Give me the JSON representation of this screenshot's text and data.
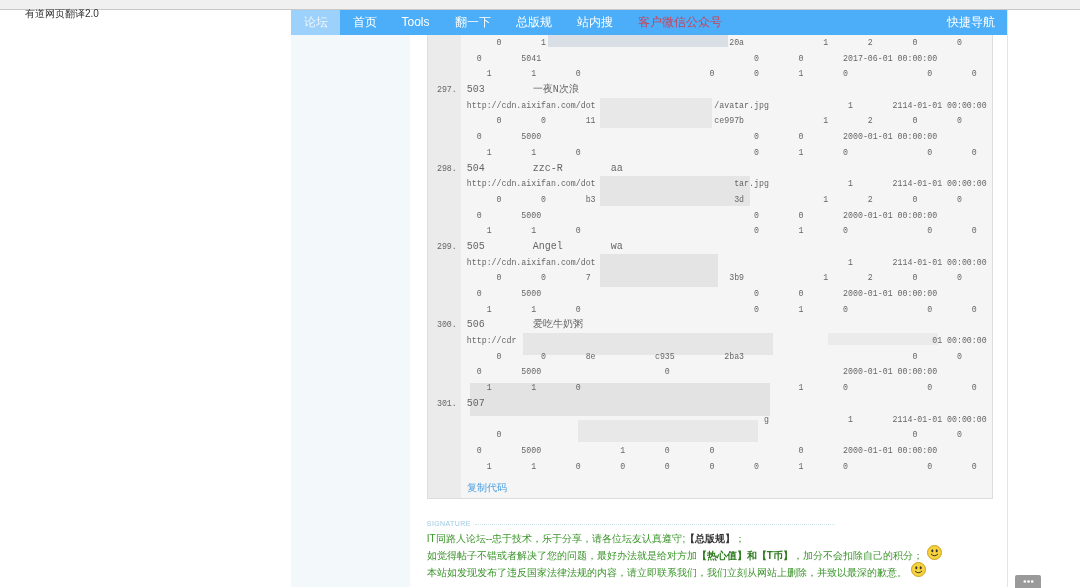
{
  "browser_bar": {
    "title": "有道网页翻译2.0"
  },
  "nav": {
    "items": [
      {
        "label": "论坛",
        "selected": true,
        "kind": "link"
      },
      {
        "label": "首页",
        "selected": false,
        "kind": "link"
      },
      {
        "label": "Tools",
        "selected": false,
        "kind": "link"
      },
      {
        "label": "翻一下",
        "selected": false,
        "kind": "link"
      },
      {
        "label": "总版规",
        "selected": false,
        "kind": "link"
      },
      {
        "label": "站内搜",
        "selected": false,
        "kind": "link"
      },
      {
        "label": "客户微信公众号",
        "selected": false,
        "kind": "promo"
      }
    ],
    "quick_nav": "快捷导航"
  },
  "code_block": {
    "lines": [
      {
        "text": "      0        1                                     20a                1        2        0        0"
      },
      {
        "text": "  0        5041                                           0        0        2017-06-01 00:00:00"
      },
      {
        "text": "    1        1        0                          0        0        1        0                0        0"
      },
      {
        "number": "297.",
        "text": "503        一夜N次浪"
      },
      {
        "text": "http://cdn.aixifan.com/dot                        /avatar.jpg                1        2114-01-01 00:00:00"
      },
      {
        "text": "      0        0        11                        ce997b                1        2        0        0"
      },
      {
        "text": "  0        5000                                           0        0        2000-01-01 00:00:00"
      },
      {
        "text": "    1        1        0                                   0        1        0                0        0"
      },
      {
        "number": "298.",
        "text": "504        zzc-R        aa"
      },
      {
        "text": "http://cdn.aixifan.com/dot                            tar.jpg                1        2114-01-01 00:00:00"
      },
      {
        "text": "      0        0        b3                            3d                1        2        0        0"
      },
      {
        "text": "  0        5000                                           0        0        2000-01-01 00:00:00"
      },
      {
        "text": "    1        1        0                                   0        1        0                0        0"
      },
      {
        "number": "299.",
        "text": "505        Angel        wa"
      },
      {
        "text": "http://cdn.aixifan.com/dot                                                   1        2114-01-01 00:00:00"
      },
      {
        "text": "      0        0        7                            3b9                1        2        0        0"
      },
      {
        "text": "  0        5000                                           0        0        2000-01-01 00:00:00"
      },
      {
        "text": "    1        1        0                                   0        1        0                0        0"
      },
      {
        "number": "300.",
        "text": "506        爱吃牛奶粥"
      },
      {
        "text": "http://cdr                                                                                    01 00:00:00"
      },
      {
        "text": "      0        0        8e            c935          2ba3                                  0        0"
      },
      {
        "text": "  0        5000                         0                                   2000-01-01 00:00:00"
      },
      {
        "text": "    1        1        0                                            1        0                0        0"
      },
      {
        "number": "301.",
        "text": "507"
      },
      {
        "text": "                                                            g                1        2114-01-01 00:00:00"
      },
      {
        "text": "      0                                                                                   0        0"
      },
      {
        "text": "  0        5000                1        0        0                 0        2000-01-01 00:00:00"
      },
      {
        "text": "    1        1        0        0        0        0        0        1        0                0        0"
      }
    ],
    "copy_link": "复制代码"
  },
  "signature": {
    "label": "SIGNATURE",
    "lines": [
      {
        "smiley": false,
        "segments": [
          {
            "kind": "text",
            "text": "IT同路人论坛--忠于技术，乐于分享，请各位坛友认真遵守;"
          },
          {
            "kind": "rule",
            "text": "【总版规】"
          },
          {
            "kind": "text",
            "text": "；"
          }
        ]
      },
      {
        "smiley": true,
        "segments": [
          {
            "kind": "text",
            "text": "如觉得帖子不错或者解决了您的问题，最好办法就是给对方加"
          },
          {
            "kind": "bold",
            "text": "【热心值】和【T币】"
          },
          {
            "kind": "text",
            "text": "，加分不会扣除自己的积分；"
          }
        ]
      },
      {
        "smiley": true,
        "segments": [
          {
            "kind": "text",
            "text": "本站如发现发布了违反国家法律法规的内容，请立即联系我们，我们立刻从网站上删除，并致以最深的歉意。"
          }
        ]
      }
    ]
  }
}
